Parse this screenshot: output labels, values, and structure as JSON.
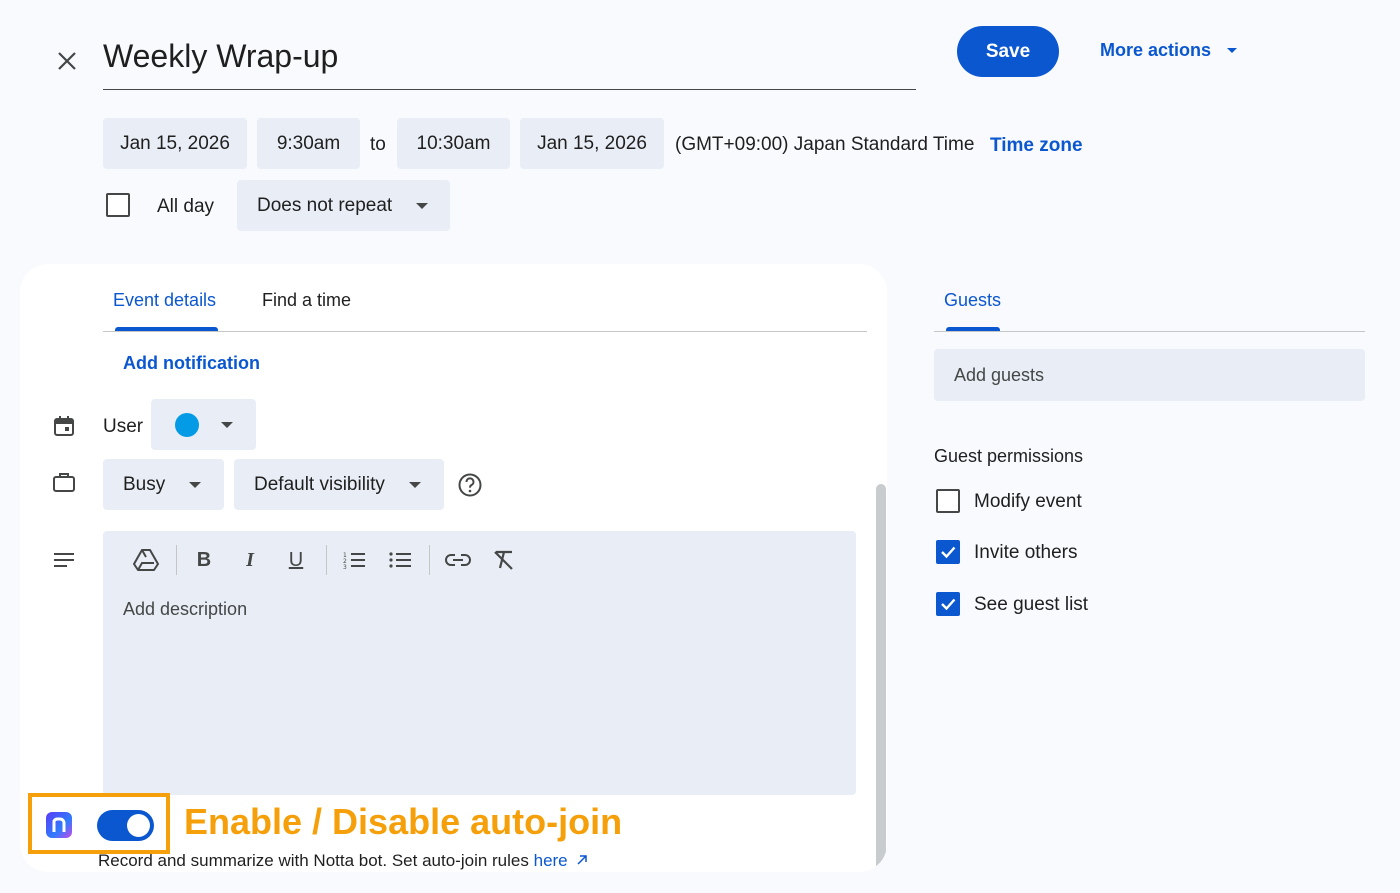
{
  "header": {
    "title": "Weekly Wrap-up",
    "save_label": "Save",
    "more_actions_label": "More actions"
  },
  "datetime": {
    "start_date": "Jan 15, 2026",
    "start_time": "9:30am",
    "to_label": "to",
    "end_time": "10:30am",
    "end_date": "Jan 15, 2026",
    "timezone_text": "(GMT+09:00) Japan Standard Time",
    "timezone_link": "Time zone",
    "all_day_label": "All day",
    "all_day_checked": false,
    "repeat_value": "Does not repeat"
  },
  "tabs": {
    "event_details": "Event details",
    "find_a_time": "Find a time",
    "guests": "Guests"
  },
  "details": {
    "add_notification": "Add notification",
    "calendar_owner": "User",
    "calendar_color": "#039be5",
    "availability": "Busy",
    "visibility": "Default visibility",
    "description_placeholder": "Add description"
  },
  "notta": {
    "annotation": "Enable / Disable auto-join",
    "annotation_color": "#f5a00a",
    "toggle_on": true,
    "footer_text": "Record and summarize with Notta bot. Set auto-join rules",
    "footer_link": "here"
  },
  "guests": {
    "placeholder": "Add guests",
    "permissions_title": "Guest permissions",
    "permissions": [
      {
        "label": "Modify event",
        "checked": false
      },
      {
        "label": "Invite others",
        "checked": true
      },
      {
        "label": "See guest list",
        "checked": true
      }
    ]
  },
  "colors": {
    "accent": "#0b57d0",
    "chip_bg": "#e9eef6",
    "page_bg": "#f8fafd"
  }
}
